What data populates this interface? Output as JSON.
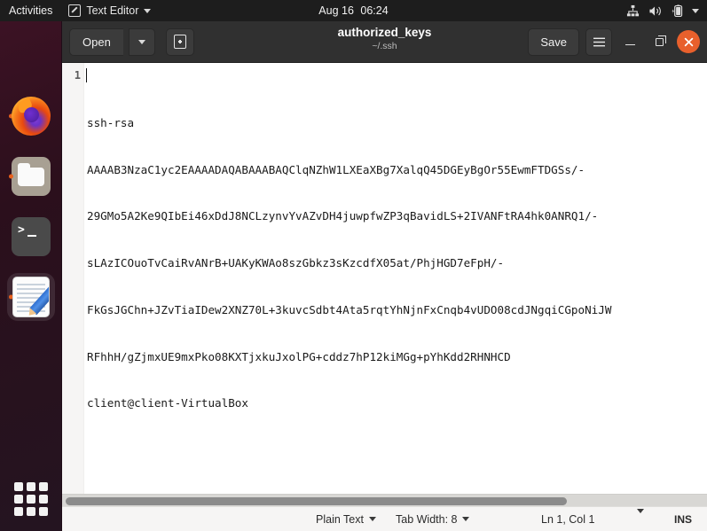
{
  "topbar": {
    "activities": "Activities",
    "app_name": "Text Editor",
    "app_icon": "text-editor-icon",
    "date": "Aug 16",
    "time": "06:24",
    "tray_icons": [
      "network-icon",
      "volume-icon",
      "battery-charging-icon",
      "chevron-down-icon"
    ]
  },
  "dock": {
    "items": [
      {
        "name": "firefox",
        "label": "Firefox",
        "running": true
      },
      {
        "name": "files",
        "label": "Files",
        "running": true
      },
      {
        "name": "terminal",
        "label": "Terminal",
        "running": false
      },
      {
        "name": "text-editor",
        "label": "Text Editor",
        "running": true,
        "active": true
      }
    ],
    "show_apps_label": "Show Applications"
  },
  "window": {
    "title": "authorized_keys",
    "subtitle": "~/.ssh",
    "open_label": "Open",
    "open_dropdown_icon": "chevron-down-icon",
    "new_document_icon": "new-document-icon",
    "save_label": "Save",
    "menu_icon": "hamburger-menu-icon",
    "minimize_icon": "minimize-icon",
    "maximize_icon": "maximize-icon",
    "close_icon": "close-icon"
  },
  "editor": {
    "line_number": "1",
    "lines": [
      "ssh-rsa",
      "AAAAB3NzaC1yc2EAAAADAQABAAABAQClqNZhW1LXEaXBg7XalqQ45DGEyBgOr55EwmFTDGSs/-",
      "29GMo5A2Ke9QIbEi46xDdJ8NCLzynvYvAZvDH4juwpfwZP3qBavidLS+2IVANFtRA4hk0ANRQ1/-",
      "sLAzICOuoTvCaiRvANrB+UAKyKWAo8szGbkz3sKzcdfX05at/PhjHGD7eFpH/-",
      "FkGsJGChn+JZvTiaIDew2XNZ70L+3kuvcSdbt4Ata5rqtYhNjnFxCnqb4vUDO08cdJNgqiCGpoNiJW",
      "RFhhH/gZjmxUE9mxPko08KXTjxkuJxolPG+cddz7hP12kiMGg+pYhKdd2RHNHCD",
      "client@client-VirtualBox"
    ]
  },
  "statusbar": {
    "language": "Plain Text",
    "tab_width": "Tab Width: 8",
    "position": "Ln 1, Col 1",
    "insert_mode": "INS"
  },
  "colors": {
    "accent": "#e8602c",
    "headerbar": "#303030",
    "topbar": "#1d1d1d",
    "dock": "#2b0f1c",
    "status_bg": "#f6f5f4"
  }
}
